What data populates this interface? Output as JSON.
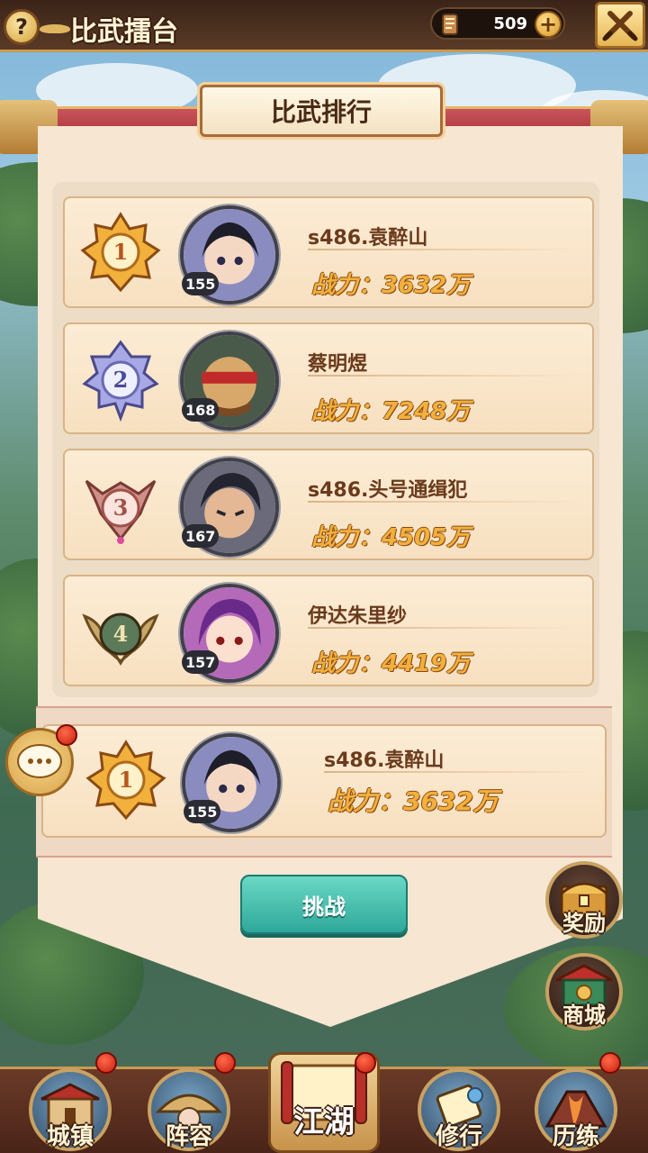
{
  "header": {
    "help_label": "?",
    "title": "比武擂台",
    "currency_value": "509",
    "plus_label": "+"
  },
  "section": {
    "title": "比武排行"
  },
  "rankings": [
    {
      "rank": "1",
      "level": "155",
      "name": "s486.袁醉山",
      "power": "战力：3632万",
      "badge_color": "#f2b03c"
    },
    {
      "rank": "2",
      "level": "168",
      "name": "蔡明煜",
      "power": "战力：7248万",
      "badge_color": "#9c9ce0"
    },
    {
      "rank": "3",
      "level": "167",
      "name": "s486.头号通缉犯",
      "power": "战力：4505万",
      "badge_color": "#c98a80"
    },
    {
      "rank": "4",
      "level": "157",
      "name": "伊达朱里纱",
      "power": "战力：4419万",
      "badge_color": "#a08a5a"
    }
  ],
  "self": {
    "rank": "1",
    "level": "155",
    "name": "s486.袁醉山",
    "power": "战力：3632万"
  },
  "actions": {
    "challenge_label": "挑战"
  },
  "side_buttons": {
    "reward_label": "奖励",
    "shop_label": "商城"
  },
  "bottom_nav": [
    {
      "label": "城镇"
    },
    {
      "label": "阵容"
    },
    {
      "label": "江湖"
    },
    {
      "label": "修行"
    },
    {
      "label": "历练"
    }
  ],
  "colors": {
    "accent_gold": "#f2b03c",
    "panel_red": "#b23a42",
    "challenge_teal": "#2fa89a"
  }
}
